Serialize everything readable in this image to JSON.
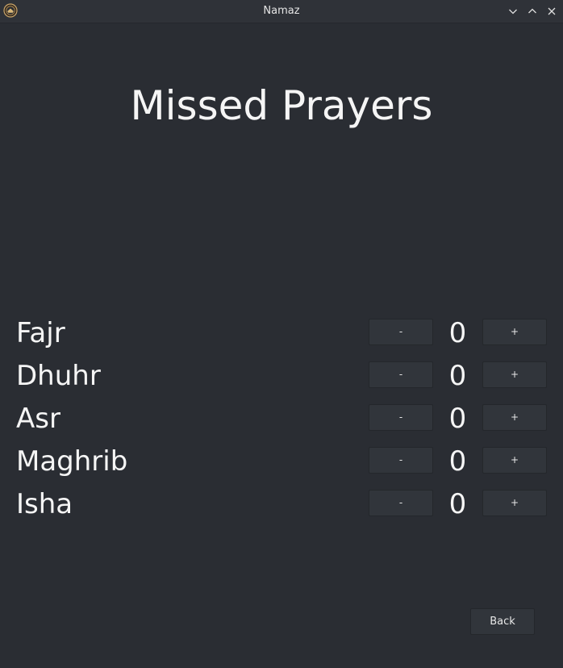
{
  "window": {
    "title": "Namaz",
    "icon": "app-emblem-icon"
  },
  "heading": "Missed Prayers",
  "prayers": [
    {
      "name": "Fajr",
      "count": "0",
      "minus_label": "-",
      "plus_label": "+"
    },
    {
      "name": "Dhuhr",
      "count": "0",
      "minus_label": "-",
      "plus_label": "+"
    },
    {
      "name": "Asr",
      "count": "0",
      "minus_label": "-",
      "plus_label": "+"
    },
    {
      "name": "Maghrib",
      "count": "0",
      "minus_label": "-",
      "plus_label": "+"
    },
    {
      "name": "Isha",
      "count": "0",
      "minus_label": "-",
      "plus_label": "+"
    }
  ],
  "back_label": "Back",
  "colors": {
    "background": "#2a2d33",
    "titlebar": "#2f3238",
    "button": "#31353b",
    "text": "#f5f5f5"
  }
}
